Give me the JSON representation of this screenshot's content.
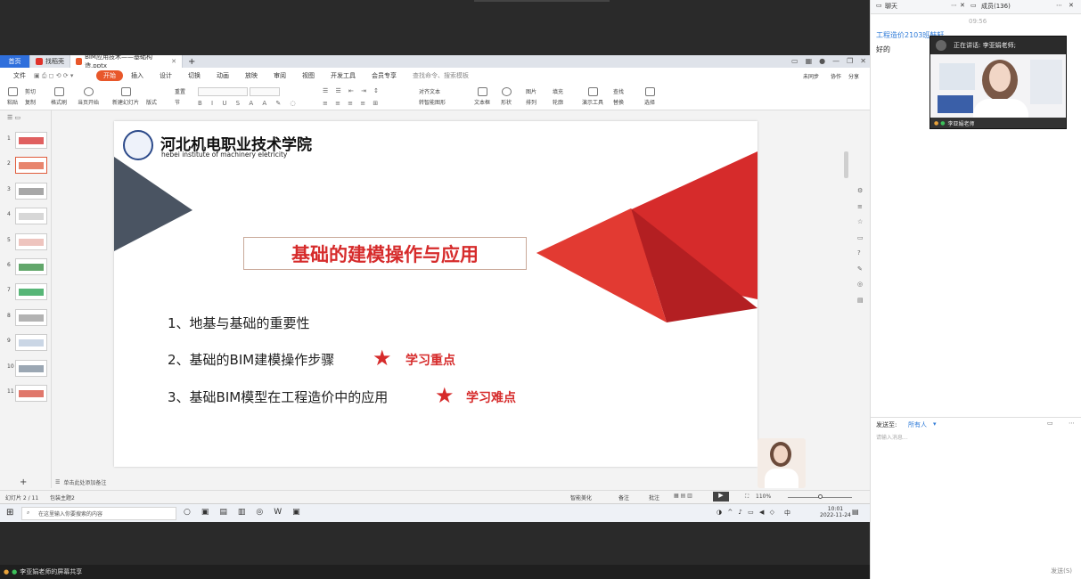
{
  "window": {
    "tab_home": "首页",
    "tab_template": "找稻壳",
    "tab_doc": "BIM应用技术——基础构造.pptx"
  },
  "menus": [
    "文件",
    "开始",
    "插入",
    "设计",
    "切换",
    "动画",
    "放映",
    "审阅",
    "视图",
    "开发工具",
    "会员专享",
    "查找命令、搜索模板",
    "未同步",
    "协作",
    "分享"
  ],
  "ribbon": {
    "paste": "粘贴",
    "cut": "剪切",
    "copy": "复制",
    "format_painter": "格式刷",
    "play_from_current": "当页开始",
    "new_slide": "新建幻灯片",
    "layout": "版式",
    "section": "节",
    "reset": "重置",
    "text_box": "文本框",
    "shape": "形状",
    "picture": "图片",
    "arrange": "排列",
    "fill": "填充",
    "outline": "轮廓",
    "align": "对齐文本",
    "convert_smartart": "转智能图形",
    "presentation_tools": "演示工具",
    "find": "查找",
    "replace": "替换",
    "select": "选择"
  },
  "thumbnails": [
    "1",
    "2",
    "3",
    "4",
    "5",
    "6",
    "7",
    "8",
    "9",
    "10",
    "11"
  ],
  "slide": {
    "school_cn": "河北机电职业技术学院",
    "school_en": "hebei institute of machinery eletricity",
    "title": "基础的建模操作与应用",
    "item1": "1、地基与基础的重要性",
    "item2": "2、基础的BIM建模操作步骤",
    "tag2": "学习重点",
    "item3": "3、基础BIM模型在工程造价中的应用",
    "tag3": "学习难点"
  },
  "notes_placeholder": "单击此处添加备注",
  "status": {
    "page": "幻灯片 2 / 11",
    "theme": "包装主题2",
    "beautify": "智能美化",
    "notes": "备注",
    "comments": "批注",
    "zoom": "110%"
  },
  "taskbar": {
    "search_placeholder": "在这里输入你要搜索的内容",
    "ime": "中",
    "time": "10:01",
    "date": "2022-11-24"
  },
  "bottom_bar": {
    "share_label": "李亚娟老师的屏幕共享"
  },
  "panel": {
    "tab_chat": "聊天",
    "tab_members": "成员(136)",
    "time": "09:56",
    "chat_sender": "工程造价2103班韩轩",
    "chat_message": "好的",
    "speaking_label": "正在讲话: 李亚娟老师;",
    "teacher_name": "李亚娟老师",
    "send_to_label": "发送至:",
    "send_to_value": "所有人",
    "message_placeholder": "请输入消息...",
    "send_button": "发送(S)"
  },
  "colors": {
    "accent_red": "#d62b2b",
    "ribbon_orange": "#e8572a",
    "slate": "#4a5462",
    "link_blue": "#2f7bd8"
  }
}
